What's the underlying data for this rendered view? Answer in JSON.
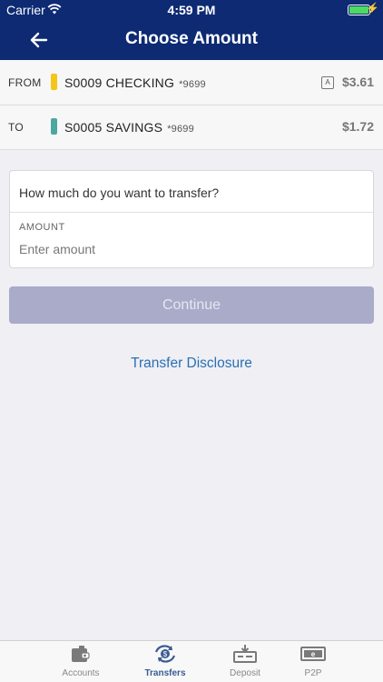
{
  "status": {
    "carrier": "Carrier",
    "time": "4:59 PM"
  },
  "nav": {
    "title": "Choose Amount"
  },
  "from": {
    "label": "FROM",
    "name": "S0009 CHECKING",
    "account": "*9699",
    "badge": "A",
    "amount": "$3.61",
    "marker_color": "#f5c518"
  },
  "to": {
    "label": "TO",
    "name": "S0005 SAVINGS",
    "account": "*9699",
    "amount": "$1.72",
    "marker_color": "#4ba8a0"
  },
  "form": {
    "question": "How much do you want to transfer?",
    "amount_label": "AMOUNT",
    "amount_placeholder": "Enter amount",
    "amount_value": ""
  },
  "continue_label": "Continue",
  "disclosure_link": "Transfer Disclosure",
  "tabs": [
    {
      "label": "Accounts",
      "icon": "wallet-icon",
      "active": false
    },
    {
      "label": "Transfers",
      "icon": "transfer-icon",
      "active": true
    },
    {
      "label": "Deposit",
      "icon": "deposit-icon",
      "active": false
    },
    {
      "label": "P2P",
      "icon": "p2p-icon",
      "active": false
    }
  ],
  "colors": {
    "nav": "#0d2a73",
    "accent": "#2a6fb3",
    "button_disabled": "#a9abc9"
  }
}
